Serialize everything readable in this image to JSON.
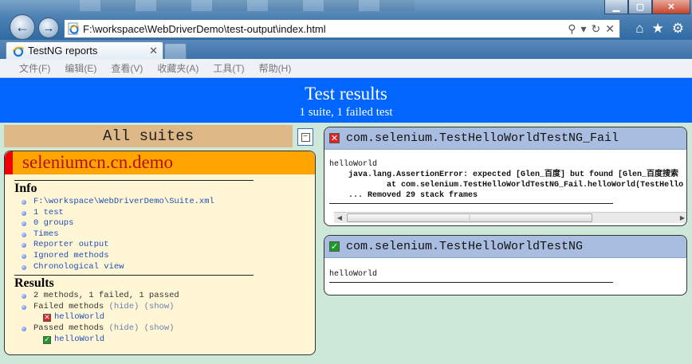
{
  "browser": {
    "address": "F:\\workspace\\WebDriverDemo\\test-output\\index.html",
    "tab_title": "TestNG reports",
    "menu": [
      "文件(F)",
      "编辑(E)",
      "查看(V)",
      "收藏夹(A)",
      "工具(T)",
      "帮助(H)"
    ]
  },
  "banner": {
    "title": "Test results",
    "subtitle": "1 suite, 1 failed test"
  },
  "left": {
    "suites_header": "All suites",
    "collapse_symbol": "−",
    "suite_name": "seleniumcn.cn.demo",
    "info_title": "Info",
    "info_items": [
      "F:\\workspace\\WebDriverDemo\\Suite.xml",
      "1 test",
      "0 groups",
      "Times",
      "Reporter output",
      "Ignored methods",
      "Chronological view"
    ],
    "results_title": "Results",
    "summary": "2 methods, 1 failed, 1 passed",
    "failed_label": "Failed methods",
    "passed_label": "Passed methods",
    "hide_label": "(hide)",
    "show_label": "(show)",
    "failed_method": "helloWorld",
    "passed_method": "helloWorld"
  },
  "tests": {
    "fail_class": "com.selenium.TestHelloWorldTestNG_Fail",
    "fail_output": "helloWorld",
    "fail_trace_1": "    java.lang.AssertionError: expected [Glen_百度] but found [Glen_百度搜索",
    "fail_trace_2": "            at com.selenium.TestHelloWorldTestNG_Fail.helloWorld(TestHello",
    "fail_trace_3": "    ... Removed 29 stack frames",
    "pass_class": "com.selenium.TestHelloWorldTestNG",
    "pass_output": "helloWorld"
  },
  "colors": {
    "banner": "#0066ff",
    "suite_header": "#deb887",
    "suite_title": "#ffa500",
    "fail": "#dd2222",
    "pass": "#1b9b26"
  }
}
